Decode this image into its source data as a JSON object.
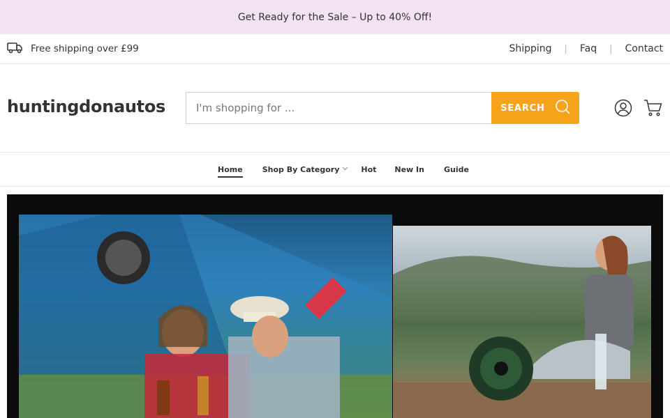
{
  "announcement": {
    "text": "Get Ready for the Sale – Up to 40% Off!"
  },
  "topbar": {
    "shipping_text": "Free shipping over £99",
    "shipping_icon": "truck-icon",
    "links": [
      {
        "label": "Shipping"
      },
      {
        "label": "Faq"
      },
      {
        "label": "Contact"
      }
    ],
    "separator": "|"
  },
  "header": {
    "logo": "huntingdonautos",
    "search": {
      "placeholder": "I'm shopping for ...",
      "value": "",
      "button_label": "SEARCH",
      "icon": "search-icon"
    },
    "account_icon": "user-icon",
    "cart_icon": "cart-icon"
  },
  "nav": {
    "items": [
      {
        "label": "Home",
        "active": true
      },
      {
        "label": "Shop By Category",
        "has_dropdown": true
      },
      {
        "label": "Hot"
      },
      {
        "label": "New In"
      },
      {
        "label": "Guide"
      }
    ]
  },
  "colors": {
    "announcement_bg": "#f2e2f2",
    "accent": "#f7a21b",
    "text": "#333333"
  },
  "hero": {
    "images": [
      {
        "description_icon": "camping-couple-with-fan-image"
      },
      {
        "description_icon": "woman-sitting-with-fan-image"
      }
    ]
  }
}
